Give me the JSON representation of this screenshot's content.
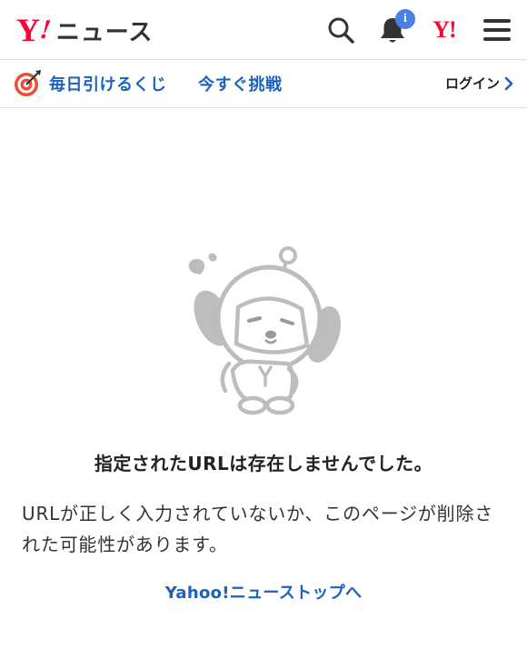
{
  "header": {
    "logo": {
      "y_mark": "Y",
      "bang": "!",
      "section": "ニュース"
    },
    "search_icon": "search-icon",
    "bell_icon": "bell-icon",
    "notification_badge": "i",
    "yj_mark": "Y!",
    "menu_icon": "hamburger-menu-icon"
  },
  "promo": {
    "icon": "target-dart-icon",
    "label": "毎日引けるくじ",
    "cta": "今すぐ挑戦",
    "login_label": "ログイン"
  },
  "error": {
    "illustration": "sad-dog-mascot-icon",
    "title": "指定されたURLは存在しませんでした。",
    "description": "URLが正しく入力されていないか、このページが削除された可能性があります。",
    "top_link": "Yahoo!ニューストップへ"
  },
  "colors": {
    "brand_red": "#ff0033",
    "link_blue": "#1a62bd",
    "badge_blue": "#4a7fe6",
    "divider": "#dcdcdc",
    "mascot_gray": "#bdbdbd"
  }
}
